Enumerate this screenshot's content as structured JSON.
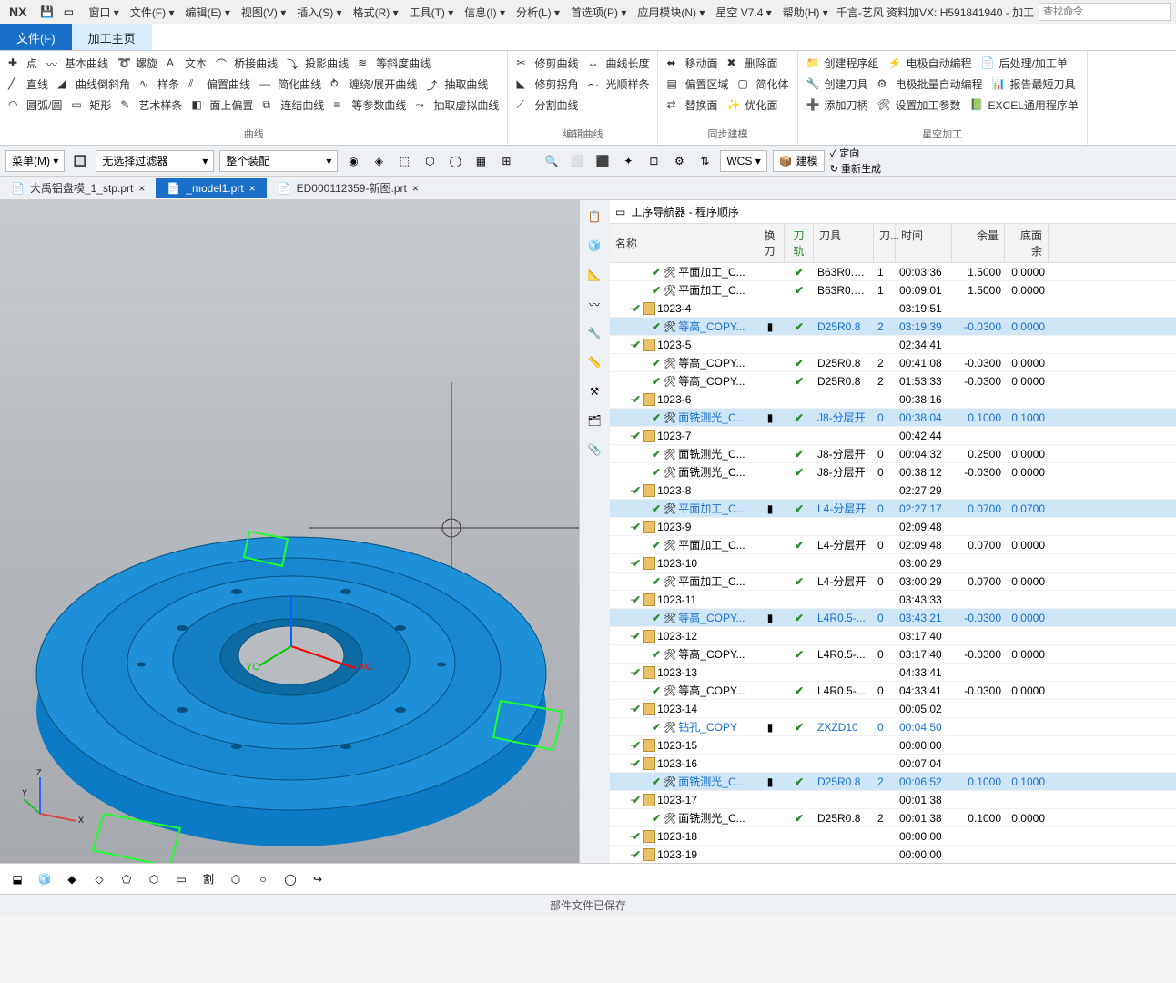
{
  "app": {
    "logo": "NX",
    "title": "千言-艺风 资料加VX: H591841940 - 加工",
    "search_ph": "查找命令"
  },
  "menu": [
    "窗口 ▾",
    "文件(F) ▾",
    "编辑(E) ▾",
    "视图(V) ▾",
    "插入(S) ▾",
    "格式(R) ▾",
    "工具(T) ▾",
    "信息(I) ▾",
    "分析(L) ▾",
    "首选项(P) ▾",
    "应用模块(N) ▾",
    "星空 V7.4 ▾",
    "帮助(H) ▾"
  ],
  "apptabs": {
    "file": "文件(F)",
    "cam": "加工主页"
  },
  "ribbon": {
    "g1": {
      "r1": [
        "点",
        "基本曲线",
        "螺旋",
        "文本",
        "桥接曲线",
        "投影曲线",
        "等斜度曲线"
      ],
      "r2": [
        "直线",
        "曲线倒斜角",
        "样条",
        "偏置曲线",
        "简化曲线",
        "缠绕/展开曲线",
        "抽取曲线"
      ],
      "r3": [
        "圆弧/圆",
        "矩形",
        "艺术样条",
        "面上偏置",
        "连结曲线",
        "等参数曲线",
        "抽取虚拟曲线"
      ],
      "label": "曲线"
    },
    "g2": {
      "r1": [
        "修剪曲线",
        "曲线长度"
      ],
      "r2": [
        "修剪拐角",
        "光顺样条"
      ],
      "r3": [
        "分割曲线"
      ],
      "label": "编辑曲线"
    },
    "g3": {
      "r1": [
        "移动面",
        "删除面"
      ],
      "r2": [
        "偏置区域",
        "简化体"
      ],
      "r3": [
        "替换面",
        "优化面"
      ],
      "label": "同步建模"
    },
    "g4": {
      "r1": [
        "创建程序组",
        "电极自动编程",
        "后处理/加工单"
      ],
      "r2": [
        "创建刀具",
        "电极批量自动编程",
        "报告最短刀具"
      ],
      "r3": [
        "添加刀柄",
        "设置加工参数",
        "EXCEL通用程序单"
      ],
      "label": "星空加工"
    }
  },
  "selbar": {
    "menu": "菜单(M) ▾",
    "filter": "无选择过滤器",
    "asm": "整个装配",
    "wcs": "WCS ▾",
    "model": "建模",
    "orient": "定向",
    "regen": "重新生成"
  },
  "doctabs": [
    {
      "label": "大禹铝盘模_1_stp.prt",
      "close": "×"
    },
    {
      "label": "_model1.prt",
      "close": "×",
      "active": true
    },
    {
      "label": "ED000112359-新图.prt",
      "close": "×"
    }
  ],
  "nav": {
    "title": "工序导航器 - 程序顺序",
    "cols": {
      "name": "名称",
      "hd": "换刀",
      "dg": "刀轨",
      "tool": "刀具",
      "dn": "刀...",
      "time": "时间",
      "yu": "余量",
      "dm": "底面余"
    }
  },
  "rows": [
    {
      "t": 2,
      "n": "平面加工_C...",
      "dg": 1,
      "tool": "B63R0.8-...",
      "dn": "1",
      "time": "00:03:36",
      "yu": "1.5000",
      "dm": "0.0000"
    },
    {
      "t": 2,
      "n": "平面加工_C...",
      "dg": 1,
      "tool": "B63R0.8-...",
      "dn": "1",
      "time": "00:09:01",
      "yu": "1.5000",
      "dm": "0.0000"
    },
    {
      "t": 1,
      "n": "1023-4",
      "time": "03:19:51"
    },
    {
      "t": 2,
      "n": "等高_COPY...",
      "hd": 1,
      "dg": 1,
      "tool": "D25R0.8",
      "dn": "2",
      "time": "03:19:39",
      "yu": "-0.0300",
      "dm": "0.0000",
      "sel": 1,
      "blue": 1
    },
    {
      "t": 1,
      "n": "1023-5",
      "time": "02:34:41"
    },
    {
      "t": 2,
      "n": "等高_COPY...",
      "dg": 1,
      "tool": "D25R0.8",
      "dn": "2",
      "time": "00:41:08",
      "yu": "-0.0300",
      "dm": "0.0000"
    },
    {
      "t": 2,
      "n": "等高_COPY...",
      "dg": 1,
      "tool": "D25R0.8",
      "dn": "2",
      "time": "01:53:33",
      "yu": "-0.0300",
      "dm": "0.0000"
    },
    {
      "t": 1,
      "n": "1023-6",
      "time": "00:38:16"
    },
    {
      "t": 2,
      "n": "面铣测光_C...",
      "hd": 1,
      "dg": 1,
      "tool": "J8-分层开",
      "dn": "0",
      "time": "00:38:04",
      "yu": "0.1000",
      "dm": "0.1000",
      "sel": 1,
      "blue": 1
    },
    {
      "t": 1,
      "n": "1023-7",
      "time": "00:42:44"
    },
    {
      "t": 2,
      "n": "面铣测光_C...",
      "dg": 1,
      "tool": "J8-分层开",
      "dn": "0",
      "time": "00:04:32",
      "yu": "0.2500",
      "dm": "0.0000"
    },
    {
      "t": 2,
      "n": "面铣测光_C...",
      "dg": 1,
      "tool": "J8-分层开",
      "dn": "0",
      "time": "00:38:12",
      "yu": "-0.0300",
      "dm": "0.0000"
    },
    {
      "t": 1,
      "n": "1023-8",
      "time": "02:27:29"
    },
    {
      "t": 2,
      "n": "平面加工_C...",
      "hd": 1,
      "dg": 1,
      "tool": "L4-分层开",
      "dn": "0",
      "time": "02:27:17",
      "yu": "0.0700",
      "dm": "0.0700",
      "sel": 1,
      "blue": 1
    },
    {
      "t": 1,
      "n": "1023-9",
      "time": "02:09:48"
    },
    {
      "t": 2,
      "n": "平面加工_C...",
      "dg": 1,
      "tool": "L4-分层开",
      "dn": "0",
      "time": "02:09:48",
      "yu": "0.0700",
      "dm": "0.0000"
    },
    {
      "t": 1,
      "n": "1023-10",
      "time": "03:00:29"
    },
    {
      "t": 2,
      "n": "平面加工_C...",
      "dg": 1,
      "tool": "L4-分层开",
      "dn": "0",
      "time": "03:00:29",
      "yu": "0.0700",
      "dm": "0.0000"
    },
    {
      "t": 1,
      "n": "1023-11",
      "time": "03:43:33"
    },
    {
      "t": 2,
      "n": "等高_COPY...",
      "hd": 1,
      "dg": 1,
      "tool": "L4R0.5-...",
      "dn": "0",
      "time": "03:43:21",
      "yu": "-0.0300",
      "dm": "0.0000",
      "sel": 1,
      "blue": 1
    },
    {
      "t": 1,
      "n": "1023-12",
      "time": "03:17:40"
    },
    {
      "t": 2,
      "n": "等高_COPY...",
      "dg": 1,
      "tool": "L4R0.5-...",
      "dn": "0",
      "time": "03:17:40",
      "yu": "-0.0300",
      "dm": "0.0000"
    },
    {
      "t": 1,
      "n": "1023-13",
      "time": "04:33:41"
    },
    {
      "t": 2,
      "n": "等高_COPY...",
      "dg": 1,
      "tool": "L4R0.5-...",
      "dn": "0",
      "time": "04:33:41",
      "yu": "-0.0300",
      "dm": "0.0000"
    },
    {
      "t": 1,
      "n": "1023-14",
      "time": "00:05:02"
    },
    {
      "t": 2,
      "n": "钻孔_COPY",
      "hd": 2,
      "dg": 1,
      "tool": "ZXZD10",
      "dn": "0",
      "time": "00:04:50",
      "yu": "",
      "dm": "",
      "blue": 1
    },
    {
      "t": 1,
      "n": "1023-15",
      "time": "00:00:00"
    },
    {
      "t": 1,
      "n": "1023-16",
      "time": "00:07:04"
    },
    {
      "t": 2,
      "n": "面铣测光_C...",
      "hd": 1,
      "dg": 1,
      "tool": "D25R0.8",
      "dn": "2",
      "time": "00:06:52",
      "yu": "0.1000",
      "dm": "0.1000",
      "sel": 1,
      "blue": 1
    },
    {
      "t": 1,
      "n": "1023-17",
      "time": "00:01:38"
    },
    {
      "t": 2,
      "n": "面铣测光_C...",
      "dg": 1,
      "tool": "D25R0.8",
      "dn": "2",
      "time": "00:01:38",
      "yu": "0.1000",
      "dm": "0.0000"
    },
    {
      "t": 1,
      "n": "1023-18",
      "time": "00:00:00"
    },
    {
      "t": 1,
      "n": "1023-19",
      "time": "00:00:00"
    }
  ],
  "status": "部件文件已保存",
  "axes": {
    "x": "XC",
    "y": "YC",
    "xr": "X",
    "yr": "Y",
    "zr": "Z"
  }
}
